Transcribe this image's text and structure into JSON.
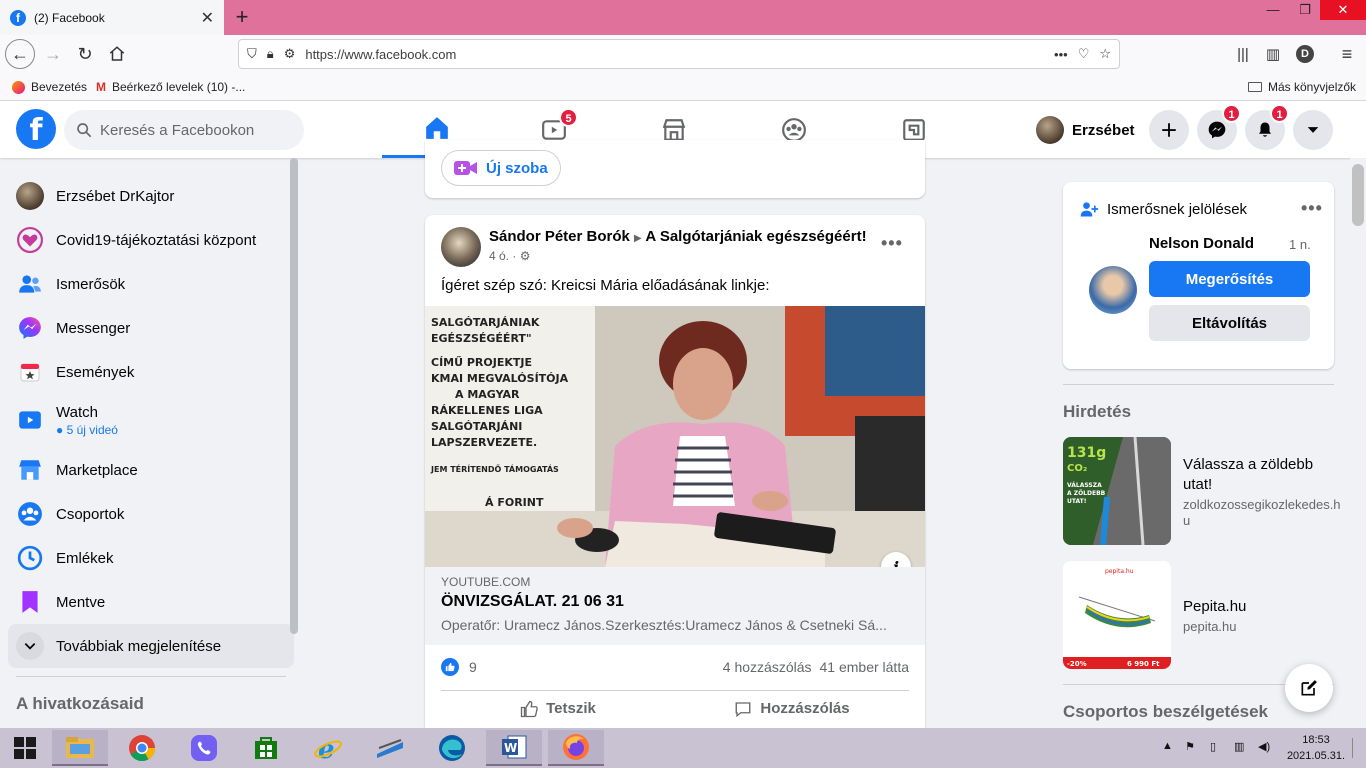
{
  "browser": {
    "tab_title": "(2) Facebook",
    "url": "https://www.facebook.com",
    "bookmarks": [
      "Bevezetés",
      "Beérkező levelek (10) -..."
    ],
    "other_bookmarks": "Más könyvjelzők",
    "profile_letter": "D"
  },
  "header": {
    "search_placeholder": "Keresés a Facebookon",
    "watch_badge": "5",
    "profile_name": "Erzsébet",
    "messenger_badge": "1",
    "notifications_badge": "1"
  },
  "sidebar": {
    "items": [
      {
        "label": "Erzsébet DrKajtor",
        "icon": "profile-avatar"
      },
      {
        "label": "Covid19-tájékoztatási központ",
        "icon": "heart-icon"
      },
      {
        "label": "Ismerősök",
        "icon": "friends-icon"
      },
      {
        "label": "Messenger",
        "icon": "messenger-icon"
      },
      {
        "label": "Események",
        "icon": "calendar-icon"
      },
      {
        "label": "Watch",
        "icon": "watch-icon",
        "sub": "5 új videó"
      },
      {
        "label": "Marketplace",
        "icon": "marketplace-icon"
      },
      {
        "label": "Csoportok",
        "icon": "groups-icon"
      },
      {
        "label": "Emlékek",
        "icon": "memories-icon"
      },
      {
        "label": "Mentve",
        "icon": "bookmark-icon"
      }
    ],
    "more_label": "Továbbiak megjelenítése",
    "shortcuts_title": "A hivatkozásaid"
  },
  "feed": {
    "new_room_label": "Új szoba",
    "post": {
      "author": "Sándor Péter Borók",
      "group": "A Salgótarjániak egészségéért!",
      "time": "4 ó. ·",
      "text": "Ígéret szép szó: Kreicsi Mária előadásának linkje:",
      "link_domain": "YOUTUBE.COM",
      "link_title": "ÖNVIZSGÁLAT. 21 06 31",
      "link_desc": "Operatőr: Uramecz János.Szerkesztés:Uramecz János & Csetneki Sá...",
      "likes": "9",
      "comments": "4 hozzászólás",
      "views": "41 ember látta",
      "like_action": "Tetszik",
      "comment_action": "Hozzászólás",
      "video_poster_lines": [
        "SALGÓTARJÁNIAK",
        "EGÉSZSÉGÉÉRT\"",
        "CÍMŰ PROJEKTJE",
        "KMAI MEGVALÓSÍTÓJA",
        "A MAGYAR",
        "RÁKELLENES LIGA",
        "SALGÓTARJÁNI",
        "LAPSZERVEZETE.",
        "JEM TÉRÍTENDŐ TÁMOGATÁS",
        "Á FORINT"
      ]
    }
  },
  "right": {
    "friend_requests_title": "Ismerősnek jelölések",
    "request_name": "Nelson Donald",
    "request_time": "1 n.",
    "confirm_label": "Megerősítés",
    "remove_label": "Eltávolítás",
    "ads_title": "Hirdetés",
    "ads": [
      {
        "title": "Válassza a zöldebb utat!",
        "domain": "zoldkozossegikozlekedes.hu",
        "thumb_texts": [
          "131g",
          "CO₂",
          "VÁLASSZA",
          "A ZÖLDEBB",
          "UTAT!"
        ]
      },
      {
        "title": "Pepita.hu",
        "domain": "pepita.hu",
        "thumb_texts": [
          "pepita.hu",
          "-20%",
          "6 990 Ft"
        ]
      }
    ],
    "group_chats_title": "Csoportos beszélgetések"
  },
  "taskbar": {
    "time": "18:53",
    "date": "2021.05.31."
  },
  "colors": {
    "fb_blue": "#1877f2",
    "tabbar": "#e0719a",
    "badge_red": "#e41e3f",
    "taskbar": "#c9c2d3"
  }
}
